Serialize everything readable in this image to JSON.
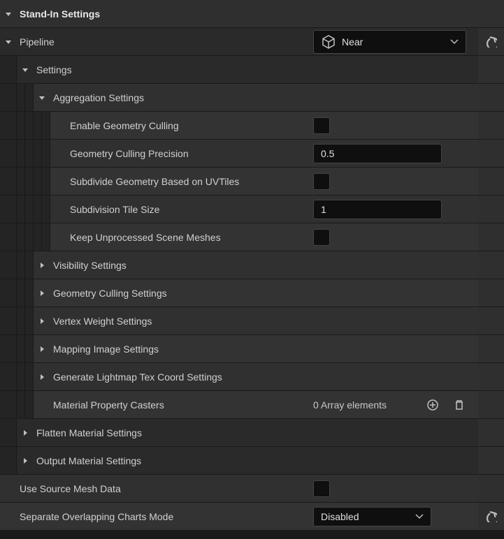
{
  "header": {
    "title": "Stand-In Settings"
  },
  "pipeline": {
    "label": "Pipeline",
    "value": "Near"
  },
  "settings": {
    "label": "Settings",
    "aggregation": {
      "label": "Aggregation Settings",
      "enable_geometry_culling": {
        "label": "Enable Geometry Culling",
        "checked": false
      },
      "geometry_culling_precision": {
        "label": "Geometry Culling Precision",
        "value": "0.5"
      },
      "subdivide_uvtiles": {
        "label": "Subdivide Geometry Based on UVTiles",
        "checked": false
      },
      "subdivision_tile_size": {
        "label": "Subdivision Tile Size",
        "value": "1"
      },
      "keep_unprocessed": {
        "label": "Keep Unprocessed Scene Meshes",
        "checked": false
      }
    },
    "visibility": {
      "label": "Visibility Settings"
    },
    "geometry_culling": {
      "label": "Geometry Culling Settings"
    },
    "vertex_weight": {
      "label": "Vertex Weight Settings"
    },
    "mapping_image": {
      "label": "Mapping Image Settings"
    },
    "generate_lightmap": {
      "label": "Generate Lightmap Tex Coord Settings"
    },
    "material_casters": {
      "label": "Material Property Casters",
      "value": "0 Array elements"
    }
  },
  "flatten_material": {
    "label": "Flatten Material Settings"
  },
  "output_material": {
    "label": "Output Material Settings"
  },
  "use_source_mesh": {
    "label": "Use Source Mesh Data",
    "checked": false
  },
  "separate_charts": {
    "label": "Separate Overlapping Charts Mode",
    "value": "Disabled"
  }
}
